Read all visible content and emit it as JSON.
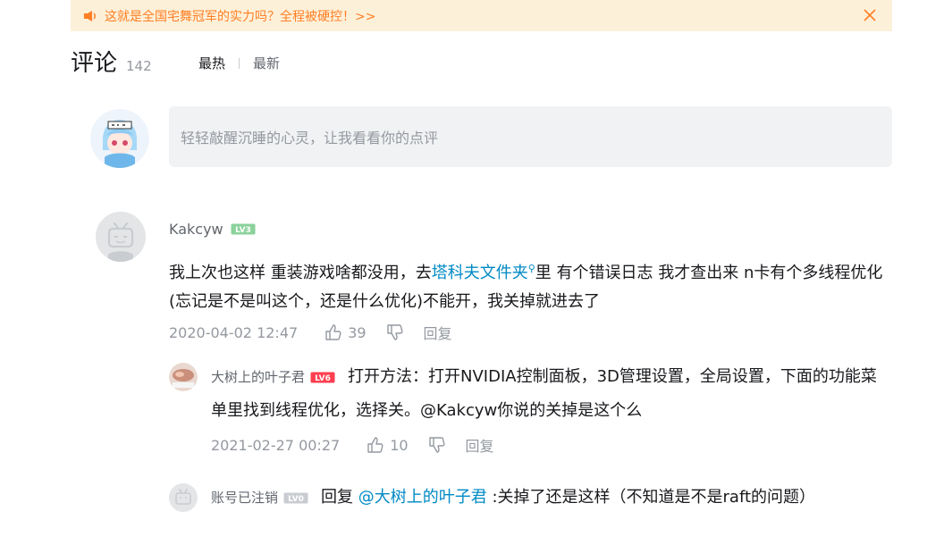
{
  "notice": {
    "text": "这就是全国宅舞冠军的实力吗？全程被硬控！>>"
  },
  "header": {
    "title": "评论",
    "count": "142",
    "sort_hot": "最热",
    "sort_new": "最新"
  },
  "composer": {
    "placeholder": "轻轻敲醒沉睡的心灵，让我看看你的点评"
  },
  "comment": {
    "username": "Kakcyw",
    "level": "LV3",
    "text_before": "我上次也这样 重装游戏啥都没用，去",
    "link_text": "塔科夫文件夹",
    "text_after": "里 有个错误日志 我才查出来 n卡有个多线程优化(忘记是不是叫这个，还是什么优化)不能开，我关掉就进去了",
    "time": "2020-04-02 12:47",
    "likes": "39",
    "reply_label": "回复"
  },
  "replies": [
    {
      "username": "大树上的叶子君",
      "level": "LV6",
      "text": "打开方法：打开NVIDIA控制面板，3D管理设置，全局设置，下面的功能菜单里找到线程优化，选择关。@Kakcyw你说的关掉是这个么",
      "time": "2021-02-27 00:27",
      "likes": "10",
      "reply_label": "回复"
    },
    {
      "username": "账号已注销",
      "level": "LV0",
      "reply_prefix": "回复 ",
      "at_user": "@大树上的叶子君",
      "text": " :关掉了还是这样（不知道是不是raft的问题）"
    }
  ]
}
